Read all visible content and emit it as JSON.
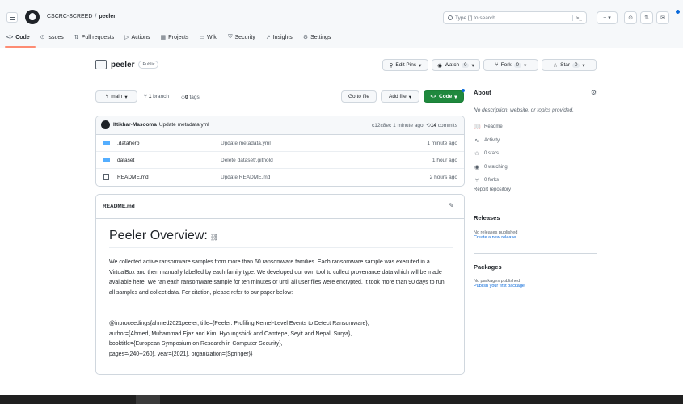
{
  "header": {
    "owner": "CSCRC-SCREED",
    "separator": "/",
    "repo": "peeler",
    "search_placeholder": "Type [/] to search",
    "terminal_glyph": ">_",
    "plus_label": "+ ▾"
  },
  "nav": [
    {
      "icon": "<>",
      "label": "Code",
      "active": true
    },
    {
      "icon": "⊙",
      "label": "Issues"
    },
    {
      "icon": "⇅",
      "label": "Pull requests"
    },
    {
      "icon": "▷",
      "label": "Actions"
    },
    {
      "icon": "▦",
      "label": "Projects"
    },
    {
      "icon": "▭",
      "label": "Wiki"
    },
    {
      "icon": "⛨",
      "label": "Security"
    },
    {
      "icon": "↗",
      "label": "Insights"
    },
    {
      "icon": "⚙",
      "label": "Settings"
    }
  ],
  "repo": {
    "name": "peeler",
    "visibility": "Public",
    "edit_pins": "Edit Pins",
    "watch_label": "Watch",
    "watch_count": "0",
    "fork_label": "Fork",
    "fork_count": "0",
    "star_label": "Star",
    "star_count": "0"
  },
  "branch_bar": {
    "branch": "main",
    "branches_count": "1",
    "branches_label": "branch",
    "tags_count": "0",
    "tags_label": "tags",
    "go_to_file": "Go to file",
    "add_file": "Add file",
    "code_button": "Code"
  },
  "latest_commit": {
    "author": "Iftikhar-Masooma",
    "message": "Update metadata.yml",
    "hash": "c12c8ec",
    "time": "1 minute ago",
    "commits_count": "14",
    "commits_label": "commits"
  },
  "files": [
    {
      "type": "folder",
      "name": ".dataherb",
      "message": "Update metadata.yml",
      "date": "1 minute ago"
    },
    {
      "type": "folder",
      "name": "dataset",
      "message": "Delete dataset/.githold",
      "date": "1 hour ago"
    },
    {
      "type": "file",
      "name": "README.md",
      "message": "Update README.md",
      "date": "2 hours ago"
    }
  ],
  "readme": {
    "filename": "README.md",
    "title": "Peeler Overview:",
    "paragraph": "We collected active ransomware samples from more than 60 ransomware families. Each ransomware sample was executed in a VirtualBox and then manually labelled by each family type. We developed our own tool to collect provenance data which will be made available here. We ran each ransomware sample for ten minutes or until all user files were encrypted. It took more than 90 days to run all samples and collect data. For citation, please refer to our paper below:",
    "citation": [
      "@inproceedings{ahmed2021peeler, title={Peeler: Profiling Kernel-Level Events to Detect Ransomware},",
      "author={Ahmed, Muhammad Ejaz and Kim, Hyoungshick and Camtepe, Seyit and Nepal, Surya},",
      "booktitle={European Symposium on Research in Computer Security},",
      "pages={240--260}, year={2021}, organization={Springer}}"
    ]
  },
  "sidebar": {
    "about_title": "About",
    "about_desc": "No description, website, or topics provided.",
    "links": [
      {
        "icon": "📖",
        "label": "Readme"
      },
      {
        "icon": "∿",
        "label": "Activity"
      },
      {
        "icon": "☆",
        "label": "0 stars"
      },
      {
        "icon": "◉",
        "label": "0 watching"
      },
      {
        "icon": "⑂",
        "label": "0 forks"
      }
    ],
    "report": "Report repository",
    "releases_title": "Releases",
    "releases_empty": "No releases published",
    "releases_link": "Create a new release",
    "packages_title": "Packages",
    "packages_empty": "No packages published",
    "packages_link": "Publish your first package"
  }
}
